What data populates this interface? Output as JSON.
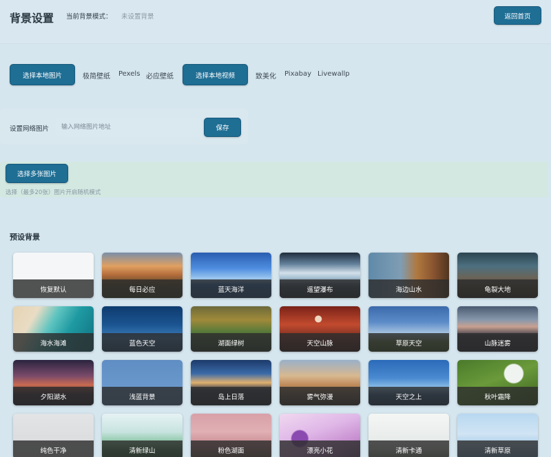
{
  "header": {
    "title": "背景设置",
    "mode_label": "当前背景模式：",
    "mode_value": "未设置背景",
    "back_button": "返回首页"
  },
  "sources": {
    "local_image_button": "选择本地图片",
    "image_links": [
      "极简壁纸",
      "Pexels",
      "必应壁纸"
    ],
    "local_video_button": "选择本地视频",
    "video_links": [
      "致美化",
      "Pixabay",
      "Livewallp"
    ]
  },
  "url_panel": {
    "label": "设置网络图片",
    "placeholder": "输入网络图片地址",
    "value": "",
    "save_button": "保存"
  },
  "multi": {
    "button": "选择多张图片",
    "hint": "选择（最多20张）图片开启随机模式"
  },
  "presets": {
    "title": "预设背景",
    "items": [
      {
        "label": "恢复默认",
        "thumb": "plain-white"
      },
      {
        "label": "每日必应",
        "thumb": "sunset-hills"
      },
      {
        "label": "蓝天海洋",
        "thumb": "blue-sky-ocean"
      },
      {
        "label": "遥望瀑布",
        "thumb": "waterfall"
      },
      {
        "label": "海边山水",
        "thumb": "sea-cliffs"
      },
      {
        "label": "龟裂大地",
        "thumb": "cracked-earth"
      },
      {
        "label": "海水海滩",
        "thumb": "beach"
      },
      {
        "label": "蓝色天空",
        "thumb": "blue-sky"
      },
      {
        "label": "湖面绿树",
        "thumb": "lake-trees"
      },
      {
        "label": "天空山脉",
        "thumb": "red-sky-moon"
      },
      {
        "label": "草原天空",
        "thumb": "grassland-sky"
      },
      {
        "label": "山脉迷雾",
        "thumb": "misty-mountains"
      },
      {
        "label": "夕阳湖水",
        "thumb": "sunset-lake"
      },
      {
        "label": "浅蓝背景",
        "thumb": "light-blue"
      },
      {
        "label": "岛上日落",
        "thumb": "island-sunset"
      },
      {
        "label": "雾气弥漫",
        "thumb": "foggy-windmill"
      },
      {
        "label": "天空之上",
        "thumb": "above-sky"
      },
      {
        "label": "秋叶霜降",
        "thumb": "frost-leaves"
      },
      {
        "label": "纯色干净",
        "thumb": "plain-grey"
      },
      {
        "label": "清新绿山",
        "thumb": "green-mountain"
      },
      {
        "label": "粉色湖面",
        "thumb": "pink-lake"
      },
      {
        "label": "漂亮小花",
        "thumb": "purple-flowers"
      },
      {
        "label": "清新卡通",
        "thumb": "cartoon"
      },
      {
        "label": "清新草原",
        "thumb": "fresh-grassland"
      }
    ]
  },
  "colors": {
    "accent": "#1f6e94",
    "background": "#d6e6ef",
    "multi_panel": "#d2e8e1"
  }
}
